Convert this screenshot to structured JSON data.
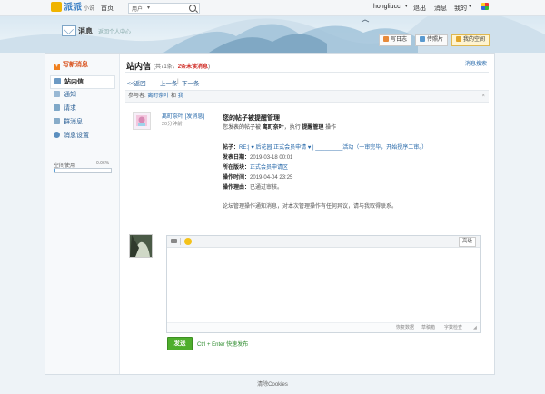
{
  "topbar": {
    "logo_main": "派派",
    "logo_sub": "小说",
    "home": "首页",
    "search_scope": "用户",
    "search_placeholder": "",
    "username": "hongliucc",
    "logout": "退出",
    "messages": "消息",
    "mine": "我的"
  },
  "banner": {
    "title": "消息",
    "back": "返回个人中心",
    "buttons": [
      "写日志",
      "传照片",
      "我的空间"
    ]
  },
  "sidebar": {
    "new_message": "写新消息",
    "items": [
      "站内信",
      "通知",
      "请求",
      "群消息",
      "消息设置"
    ],
    "space_label": "空间使用",
    "space_percent": "0.06%",
    "space_fraction": 0.0006
  },
  "main": {
    "title": "站内信",
    "count_prefix": "(共71条，",
    "count_unread": "2条未读消息",
    "count_suffix": ")",
    "search_messages": "消息搜索",
    "pager": [
      "<<返回",
      "上一条",
      "下一条"
    ],
    "participants_label": "参与者:",
    "participant_1": "离町奈叶",
    "participant_and": "和",
    "participant_2": "我",
    "sender": "离町奈叶",
    "send_link": "[发消息]",
    "time": "20分钟前",
    "subject": "您的帖子被提醒管理",
    "intro_prefix": "您发表的帖子被",
    "intro_actor": "离町奈叶",
    "intro_mid": "执行",
    "intro_action": "提醒管理",
    "intro_suffix": "操作",
    "fields": [
      {
        "k": "帖子：",
        "v": "RE:| ♥ 后花园 正式会员申请 ♥ | _________活动（一审完毕，开始授序二审。）"
      },
      {
        "k": "发表日期：",
        "v": "2019-03-18 00:01",
        "plain": true
      },
      {
        "k": "所在版块：",
        "v": "正式会员申请区"
      },
      {
        "k": "操作时间：",
        "v": "2019-04-04 23:25",
        "plain": true
      },
      {
        "k": "操作理由：",
        "v": "已通过审核。",
        "plain": true
      }
    ],
    "footnote": "论坛管理操作通知消息，对本次管理操作有任何异议，请与我取得联系。",
    "reply": {
      "advanced": "高级",
      "bottom_links": [
        "恢复数据",
        "草稿箱",
        "字数检查"
      ]
    },
    "send": "发送",
    "send_hint": "Ctrl + Enter 快速发布"
  },
  "footer": "清除Cookies"
}
